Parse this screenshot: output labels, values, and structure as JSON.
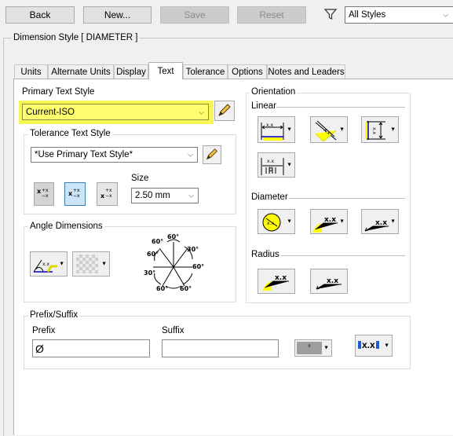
{
  "toolbar": {
    "back_label": "Back",
    "new_label": "New...",
    "save_label": "Save",
    "reset_label": "Reset",
    "filter_value": "All Styles"
  },
  "style_title": "Dimension Style [ DIAMETER ]",
  "tabs": [
    {
      "label": "Units"
    },
    {
      "label": "Alternate Units"
    },
    {
      "label": "Display"
    },
    {
      "label": "Text"
    },
    {
      "label": "Tolerance"
    },
    {
      "label": "Options"
    },
    {
      "label": "Notes and Leaders"
    }
  ],
  "active_tab": "Text",
  "primary_text": {
    "label": "Primary Text Style",
    "value": "Current-ISO",
    "highlight_color": "#f4f43a"
  },
  "tolerance_text": {
    "label": "Tolerance Text Style",
    "value": "*Use Primary Text Style*",
    "size_label": "Size",
    "size_value": "2.50 mm"
  },
  "angle_dimensions": {
    "label": "Angle Dimensions",
    "dial_labels": [
      "60°",
      "30°",
      "60°",
      "60°",
      "60°",
      "30°",
      "60°",
      "60°"
    ]
  },
  "orientation": {
    "label": "Orientation",
    "linear_label": "Linear",
    "diameter_label": "Diameter",
    "radius_label": "Radius",
    "sample_text": "x.x",
    "sample_small": "x.x"
  },
  "prefix_suffix": {
    "label": "Prefix/Suffix",
    "prefix_label": "Prefix",
    "prefix_value": "Ø",
    "suffix_label": "Suffix",
    "suffix_value": "",
    "symbol_text": "x.x",
    "degree_symbol": "°"
  }
}
